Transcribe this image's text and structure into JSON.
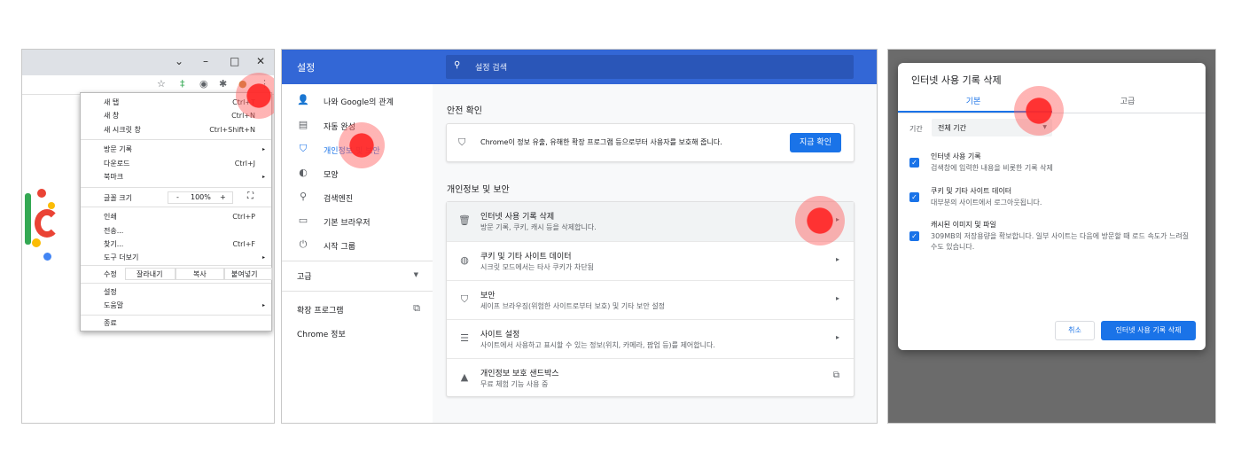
{
  "panel1": {
    "window_controls": {
      "minimize": "–",
      "maximize": "□",
      "close": "✕",
      "dropdown": "⌄"
    },
    "menu": {
      "items": [
        {
          "label": "새 탭",
          "shortcut": "Ctrl+T"
        },
        {
          "label": "새 창",
          "shortcut": "Ctrl+N"
        },
        {
          "label": "새 시크릿 창",
          "shortcut": "Ctrl+Shift+N"
        },
        {
          "label": "방문 기록",
          "shortcut": "",
          "submenu": "▸"
        },
        {
          "label": "다운로드",
          "shortcut": "Ctrl+J"
        },
        {
          "label": "북마크",
          "shortcut": "",
          "submenu": "▸"
        },
        {
          "label": "인쇄",
          "shortcut": "Ctrl+P"
        },
        {
          "label": "전송...",
          "shortcut": ""
        },
        {
          "label": "찾기...",
          "shortcut": "Ctrl+F"
        },
        {
          "label": "도구 더보기",
          "shortcut": "",
          "submenu": "▸"
        },
        {
          "label": "설정",
          "shortcut": ""
        },
        {
          "label": "도움말",
          "shortcut": "",
          "submenu": "▸"
        },
        {
          "label": "종료",
          "shortcut": ""
        }
      ],
      "zoom": {
        "label": "글꼴 크기",
        "minus": "-",
        "value": "100%",
        "plus": "+",
        "fullscreen": "⛶"
      },
      "edit": {
        "label": "수정",
        "cut": "잘라내기",
        "copy": "복사",
        "paste": "붙여넣기"
      }
    }
  },
  "panel2": {
    "header_title": "설정",
    "search_placeholder": "설정 검색",
    "nav": [
      {
        "label": "나와 Google의 관계",
        "icon": "person-icon"
      },
      {
        "label": "자동 완성",
        "icon": "clipboard-icon"
      },
      {
        "label": "개인정보 및 보안",
        "icon": "shield-icon",
        "active": true
      },
      {
        "label": "모양",
        "icon": "palette-icon"
      },
      {
        "label": "검색엔진",
        "icon": "search-icon"
      },
      {
        "label": "기본 브라우저",
        "icon": "browser-icon"
      },
      {
        "label": "시작 그룹",
        "icon": "power-icon"
      }
    ],
    "nav_advanced": "고급",
    "nav_extensions": "확장 프로그램",
    "nav_about": "Chrome 정보",
    "safety_heading": "안전 확인",
    "safety_text": "Chrome이 정보 유출, 유해한 확장 프로그램 등으로부터 사용자를 보호해 줍니다.",
    "safety_button": "지금 확인",
    "privacy_heading": "개인정보 및 보안",
    "privacy_rows": [
      {
        "title": "인터넷 사용 기록 삭제",
        "subtitle": "방문 기록, 쿠키, 캐시 등을 삭제합니다.",
        "icon": "trash-icon"
      },
      {
        "title": "쿠키 및 기타 사이트 데이터",
        "subtitle": "시크릿 모드에서는 타사 쿠키가 차단됨",
        "icon": "cookie-icon"
      },
      {
        "title": "보안",
        "subtitle": "세이프 브라우징(위험한 사이트로부터 보호) 및 기타 보안 설정",
        "icon": "shield-icon"
      },
      {
        "title": "사이트 설정",
        "subtitle": "사이트에서 사용하고 표시할 수 있는 정보(위치, 카메라, 팝업 등)를 제어합니다.",
        "icon": "sliders-icon"
      },
      {
        "title": "개인정보 보호 샌드박스",
        "subtitle": "무료 체험 기능 사용 중",
        "icon": "flask-icon"
      }
    ]
  },
  "panel3": {
    "dialog_title": "인터넷 사용 기록 삭제",
    "tab_basic": "기본",
    "tab_advanced": "고급",
    "range_label": "기간",
    "range_value": "전체 기간",
    "options": [
      {
        "title": "인터넷 사용 기록",
        "desc": "검색창에 입력한 내용을 비롯한 기록 삭제"
      },
      {
        "title": "쿠키 및 기타 사이트 데이터",
        "desc": "대부분의 사이트에서 로그아웃됩니다."
      },
      {
        "title": "캐시된 이미지 및 파일",
        "desc": "309MB의 저장용량을 확보합니다. 일부 사이트는 다음에 방문할 때 로드 속도가 느려질 수도 있습니다."
      }
    ],
    "cancel_button": "취소",
    "delete_button": "인터넷 사용 기록 삭제"
  },
  "colors": {
    "accent": "#1a73e8",
    "header": "#3367d6",
    "highlight": "#ff3b3b"
  }
}
